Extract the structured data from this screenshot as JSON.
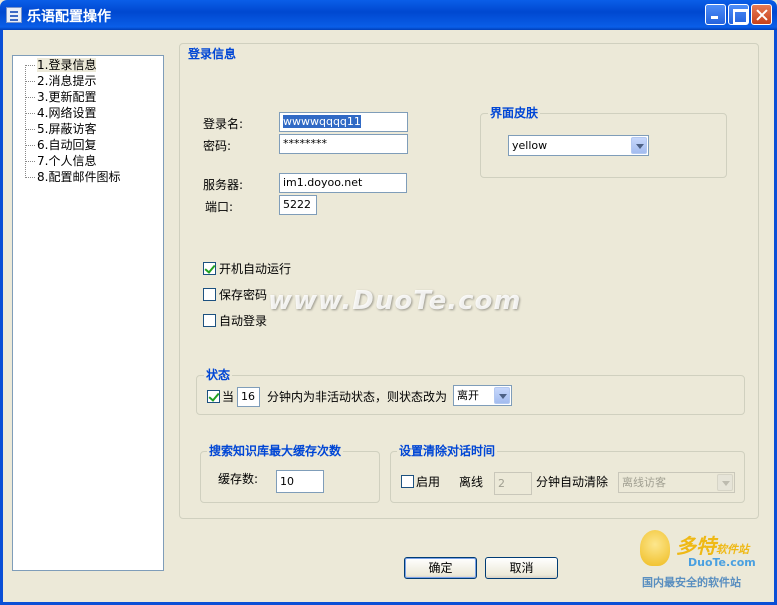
{
  "window": {
    "title": "乐语配置操作"
  },
  "nav": {
    "items": [
      {
        "label": "1.登录信息",
        "selected": true
      },
      {
        "label": "2.消息提示"
      },
      {
        "label": "3.更新配置"
      },
      {
        "label": "4.网络设置"
      },
      {
        "label": "5.屏蔽访客"
      },
      {
        "label": "6.自动回复"
      },
      {
        "label": "7.个人信息"
      },
      {
        "label": "8.配置邮件图标"
      }
    ]
  },
  "login": {
    "section_title": "登录信息",
    "username_label": "登录名:",
    "username_value": "wwwwqqqq11",
    "password_label": "密码:",
    "password_value": "********",
    "server_label": "服务器:",
    "server_value": "im1.doyoo.net",
    "port_label": "端口:",
    "port_value": "5222"
  },
  "skin": {
    "title": "界面皮肤",
    "selected": "yellow"
  },
  "options": {
    "autorun": {
      "label": "开机自动运行",
      "checked": true
    },
    "save_password": {
      "label": "保存密码",
      "checked": false
    },
    "auto_login": {
      "label": "自动登录",
      "checked": false
    }
  },
  "status": {
    "title": "状态",
    "prefix": "当",
    "minutes": "16",
    "suffix": "分钟内为非活动状态，则状态改为",
    "selected": "离开",
    "checked": true
  },
  "cache": {
    "title": "搜索知识库最大缓存次数",
    "label": "缓存数:",
    "value": "10"
  },
  "clear": {
    "title": "设置清除对话时间",
    "enable_label": "启用",
    "enabled": false,
    "offline_label": "离线",
    "minutes": "2",
    "suffix": "分钟自动清除",
    "selected": "离线访客"
  },
  "buttons": {
    "ok": "确定",
    "cancel": "取消"
  },
  "watermark": "www.DuoTe.com",
  "logo": {
    "brand": "多特",
    "brand_sub": "软件站",
    "site": "DuoTe.com",
    "tagline": "国内最安全的软件站"
  }
}
